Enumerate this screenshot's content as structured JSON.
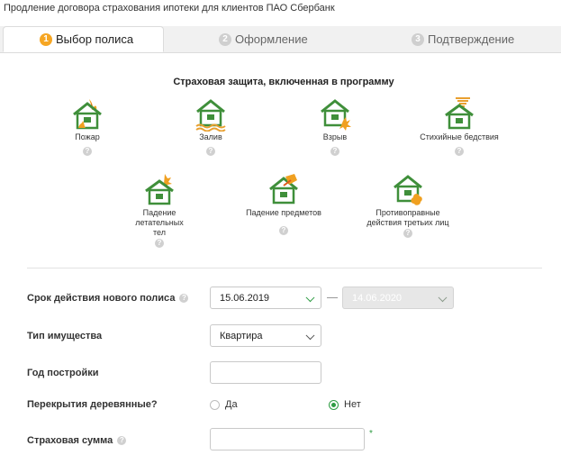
{
  "page_title": "Продление договора страхования ипотеки для клиентов ПАО Сбербанк",
  "tabs": [
    {
      "num": "1",
      "label": "Выбор полиса"
    },
    {
      "num": "2",
      "label": "Оформление"
    },
    {
      "num": "3",
      "label": "Подтверждение"
    }
  ],
  "coverage": {
    "title": "Страховая защита, включенная в программу",
    "help_glyph": "?",
    "risks": [
      {
        "label": "Пожар",
        "icon": "house-fire-icon"
      },
      {
        "label": "Залив",
        "icon": "house-flood-icon"
      },
      {
        "label": "Взрыв",
        "icon": "house-explosion-icon"
      },
      {
        "label": "Стихийные бедствия",
        "icon": "house-tornado-icon"
      },
      {
        "label": "Падение летательных тел",
        "icon": "house-falling-aircraft-icon"
      },
      {
        "label": "Падение предметов",
        "icon": "house-falling-objects-icon"
      },
      {
        "label": "Противоправные действия третьих лиц",
        "icon": "house-vandalism-icon"
      }
    ]
  },
  "form": {
    "validity": {
      "label": "Срок действия нового полиса",
      "from": "15.06.2019",
      "to": "14.06.2020"
    },
    "property_type": {
      "label": "Тип имущества",
      "value": "Квартира"
    },
    "build_year": {
      "label": "Год постройки",
      "value": ""
    },
    "wooden_floors": {
      "label": "Перекрытия деревянные?",
      "yes": "Да",
      "no": "Нет",
      "selected": "Нет"
    },
    "sum_insured": {
      "label": "Страховая сумма",
      "value": "",
      "required_mark": "*"
    }
  },
  "colors": {
    "accent_green": "#2e9c43",
    "tab_active_badge": "#f6a623",
    "house_green": "#3f8f3a"
  }
}
